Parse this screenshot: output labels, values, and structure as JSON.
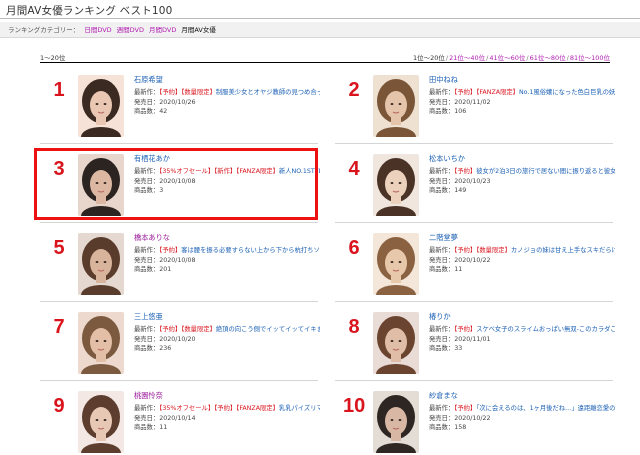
{
  "page": {
    "title": "月間AV女優ランキング ベスト100",
    "category_label": "ランキングカテゴリー：",
    "categories": [
      "日間DVD",
      "週間DVD",
      "月間DVD",
      "月間AV女優"
    ],
    "range_label": "1～20位",
    "pager": [
      "1位～20位",
      "21位～40位",
      "41位～60位",
      "61位～80位",
      "81位～100位"
    ]
  },
  "labels": {
    "latest": "最新作",
    "release": "発売日",
    "count": "商品数",
    "sep": "："
  },
  "ranking": [
    {
      "rank": "1",
      "name": "石原希望",
      "tags": [
        "【予約】",
        "【数量限定】"
      ],
      "title": "制服美少女とオヤジ教師の見つめ合って絡ませ合う禁断のベロキス…",
      "release": "2020/10/26",
      "count": "42"
    },
    {
      "rank": "2",
      "name": "田中ねね",
      "tags": [
        "【予約】",
        "【FANZA限定】"
      ],
      "title": "No.1風俗嬢になった色白巨乳の妖艶娘と3日間無制限射…",
      "release": "2020/11/02",
      "count": "106"
    },
    {
      "rank": "3",
      "name": "有栖花あか",
      "tags": [
        "【35%オフセール】",
        "【新作】",
        "【FANZA限定】"
      ],
      "title": "新人NO.1STYLE 有栖花あか",
      "release": "2020/10/08",
      "count": "3"
    },
    {
      "rank": "4",
      "name": "松本いちか",
      "tags": [
        "【予約】"
      ],
      "title": "彼女が2泊3日の旅行で居ない間に振り返ると彼女の元カノと3日間ハメまくったイチナ…",
      "release": "2020/10/23",
      "count": "149"
    },
    {
      "rank": "5",
      "name": "橋本ありな",
      "tags": [
        "【予約】"
      ],
      "title": "客は腰を振る必要すらない上から下から杭打ちソープ嬢 橋本ありな",
      "release": "2020/10/08",
      "count": "201"
    },
    {
      "rank": "6",
      "name": "二階堂夢",
      "tags": [
        "【予約】",
        "【数量限定】"
      ],
      "title": "カノジョの妹は甘え上手なスキだらけ小悪魔 二階堂夢 パンティ…",
      "release": "2020/10/22",
      "count": "11"
    },
    {
      "rank": "7",
      "name": "三上悠亜",
      "tags": [
        "【予約】",
        "【数量限定】"
      ],
      "title": "絶頂の向こう側でイッてイッてイキまくる確変オーガズム状態のま…",
      "release": "2020/10/20",
      "count": "236"
    },
    {
      "rank": "8",
      "name": "椿りか",
      "tags": [
        "【予約】"
      ],
      "title": "スケベ女子のスライムおっぱい無双-このカラダこそ私の最強の武器-椿りか",
      "release": "2020/11/01",
      "count": "33"
    },
    {
      "rank": "9",
      "name": "桃園怜奈",
      "tags": [
        "【35%オフセール】",
        "【予約】",
        "【FANZA限定】"
      ],
      "title": "乳乳パイズリマニアックス 桃園怜奈…",
      "release": "2020/10/14",
      "count": "11"
    },
    {
      "rank": "10",
      "name": "紗倉まな",
      "tags": [
        "【予約】"
      ],
      "title": "「次に会えるのは、1ヶ月後だね…」遠距離恋愛の彼女と限られた時間の中で…",
      "release": "2020/10/22",
      "count": "158"
    }
  ],
  "colors": {
    "rank": "#d9141d",
    "tag": "#d9141d",
    "link": "#1a5fb4",
    "category_link": "#b01cb0",
    "highlight_box": "#ee1111"
  }
}
